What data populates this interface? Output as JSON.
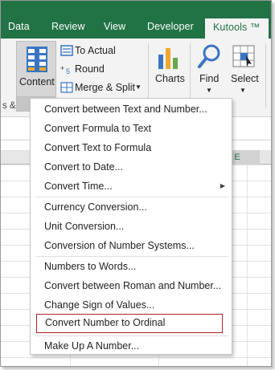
{
  "tabs": [
    {
      "label": "Data"
    },
    {
      "label": "Review"
    },
    {
      "label": "View"
    },
    {
      "label": "Developer"
    },
    {
      "label": "Kutools ™"
    }
  ],
  "ribbon": {
    "content_label": "Content",
    "to_actual": "To Actual",
    "round": "Round",
    "merge_split": "Merge & Split",
    "charts": "Charts",
    "find": "Find",
    "select": "Select",
    "group_caption_partial": "s &"
  },
  "sheet": {
    "column_e": "E"
  },
  "menu": {
    "items": [
      {
        "label": "Convert between Text and Number..."
      },
      {
        "label": "Convert Formula to Text"
      },
      {
        "label": "Convert Text to Formula"
      },
      {
        "label": "Convert to Date..."
      },
      {
        "label": "Convert Time..."
      },
      {
        "label": "Currency Conversion..."
      },
      {
        "label": "Unit Conversion..."
      },
      {
        "label": "Conversion of Number Systems..."
      },
      {
        "label": "Numbers to Words..."
      },
      {
        "label": "Convert between Roman and Number..."
      },
      {
        "label": "Change Sign of Values..."
      },
      {
        "label": "Convert Number to Ordinal"
      },
      {
        "label": "Make Up A Number..."
      }
    ]
  },
  "colors": {
    "excel_green": "#217346",
    "highlight_border": "#b22222"
  }
}
